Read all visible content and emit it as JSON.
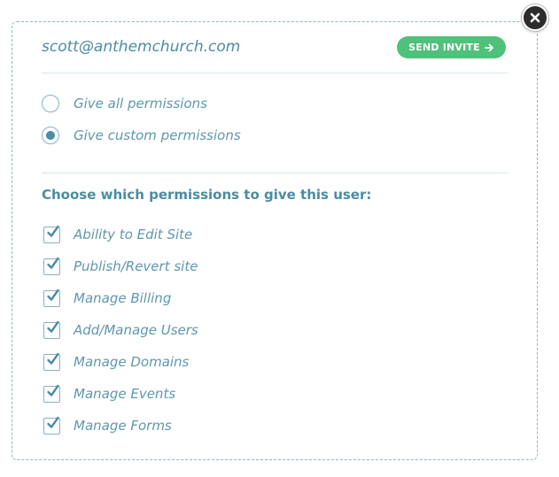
{
  "invite": {
    "email": "scott@anthemchurch.com",
    "send_label": "SEND INVITE"
  },
  "permission_mode": {
    "options": [
      {
        "label": "Give all permissions",
        "selected": false
      },
      {
        "label": "Give custom permissions",
        "selected": true
      }
    ]
  },
  "permissions": {
    "heading": "Choose which permissions to give this user:",
    "items": [
      {
        "label": "Ability to Edit Site",
        "checked": true
      },
      {
        "label": "Publish/Revert site",
        "checked": true
      },
      {
        "label": "Manage Billing",
        "checked": true
      },
      {
        "label": "Add/Manage Users",
        "checked": true
      },
      {
        "label": "Manage Domains",
        "checked": true
      },
      {
        "label": "Manage Events",
        "checked": true
      },
      {
        "label": "Manage Forms",
        "checked": true
      }
    ]
  },
  "icons": {
    "close": "close-icon",
    "arrow": "arrow-right-icon",
    "check": "checkmark-icon"
  },
  "colors": {
    "accent": "#4a8ca3",
    "button_green": "#4fc17a",
    "border": "#8fb7c4"
  }
}
